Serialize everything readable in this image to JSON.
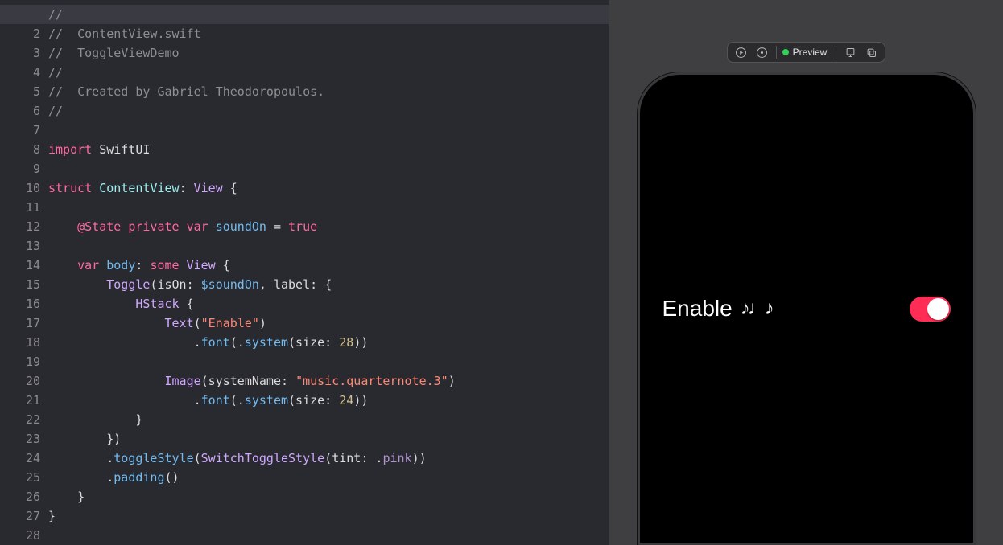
{
  "editor": {
    "lines": [
      [
        {
          "t": "//",
          "c": "comment"
        }
      ],
      [
        {
          "t": "//  ContentView.swift",
          "c": "comment"
        }
      ],
      [
        {
          "t": "//  ToggleViewDemo",
          "c": "comment"
        }
      ],
      [
        {
          "t": "//",
          "c": "comment"
        }
      ],
      [
        {
          "t": "//  Created by Gabriel Theodoropoulos.",
          "c": "comment"
        }
      ],
      [
        {
          "t": "//",
          "c": "comment"
        }
      ],
      [],
      [
        {
          "t": "import",
          "c": "keyword"
        },
        {
          "t": " "
        },
        {
          "t": "SwiftUI",
          "c": "default"
        }
      ],
      [],
      [
        {
          "t": "struct",
          "c": "keyword"
        },
        {
          "t": " "
        },
        {
          "t": "ContentView",
          "c": "typedef"
        },
        {
          "t": ": "
        },
        {
          "t": "View",
          "c": "type"
        },
        {
          "t": " {"
        }
      ],
      [],
      [
        {
          "t": "    "
        },
        {
          "t": "@State",
          "c": "keyword"
        },
        {
          "t": " "
        },
        {
          "t": "private",
          "c": "keyword"
        },
        {
          "t": " "
        },
        {
          "t": "var",
          "c": "keyword"
        },
        {
          "t": " "
        },
        {
          "t": "soundOn",
          "c": "prop"
        },
        {
          "t": " = "
        },
        {
          "t": "true",
          "c": "keyword"
        }
      ],
      [],
      [
        {
          "t": "    "
        },
        {
          "t": "var",
          "c": "keyword"
        },
        {
          "t": " "
        },
        {
          "t": "body",
          "c": "prop"
        },
        {
          "t": ": "
        },
        {
          "t": "some",
          "c": "keyword"
        },
        {
          "t": " "
        },
        {
          "t": "View",
          "c": "type"
        },
        {
          "t": " {"
        }
      ],
      [
        {
          "t": "        "
        },
        {
          "t": "Toggle",
          "c": "type"
        },
        {
          "t": "(isOn: "
        },
        {
          "t": "$soundOn",
          "c": "prop"
        },
        {
          "t": ", label: {"
        }
      ],
      [
        {
          "t": "            "
        },
        {
          "t": "HStack",
          "c": "type"
        },
        {
          "t": " {"
        }
      ],
      [
        {
          "t": "                "
        },
        {
          "t": "Text",
          "c": "type"
        },
        {
          "t": "("
        },
        {
          "t": "\"Enable\"",
          "c": "string"
        },
        {
          "t": ")"
        }
      ],
      [
        {
          "t": "                    ."
        },
        {
          "t": "font",
          "c": "prop"
        },
        {
          "t": "(."
        },
        {
          "t": "system",
          "c": "prop"
        },
        {
          "t": "(size: "
        },
        {
          "t": "28",
          "c": "number"
        },
        {
          "t": "))"
        }
      ],
      [],
      [
        {
          "t": "                "
        },
        {
          "t": "Image",
          "c": "type"
        },
        {
          "t": "(systemName: "
        },
        {
          "t": "\"music.quarternote.3\"",
          "c": "string"
        },
        {
          "t": ")"
        }
      ],
      [
        {
          "t": "                    ."
        },
        {
          "t": "font",
          "c": "prop"
        },
        {
          "t": "(."
        },
        {
          "t": "system",
          "c": "prop"
        },
        {
          "t": "(size: "
        },
        {
          "t": "24",
          "c": "number"
        },
        {
          "t": "))"
        }
      ],
      [
        {
          "t": "            }"
        }
      ],
      [
        {
          "t": "        })"
        }
      ],
      [
        {
          "t": "        ."
        },
        {
          "t": "toggleStyle",
          "c": "prop"
        },
        {
          "t": "("
        },
        {
          "t": "SwitchToggleStyle",
          "c": "type"
        },
        {
          "t": "(tint: ."
        },
        {
          "t": "pink",
          "c": "enum"
        },
        {
          "t": "))"
        }
      ],
      [
        {
          "t": "        ."
        },
        {
          "t": "padding",
          "c": "prop"
        },
        {
          "t": "()"
        }
      ],
      [
        {
          "t": "    }"
        }
      ],
      [
        {
          "t": "}"
        }
      ],
      []
    ],
    "currentLine": 1
  },
  "previewToolbar": {
    "previewLabel": "Preview"
  },
  "preview": {
    "toggleText": "Enable",
    "toggleIcon": "♪♩♪",
    "switchOn": true
  }
}
